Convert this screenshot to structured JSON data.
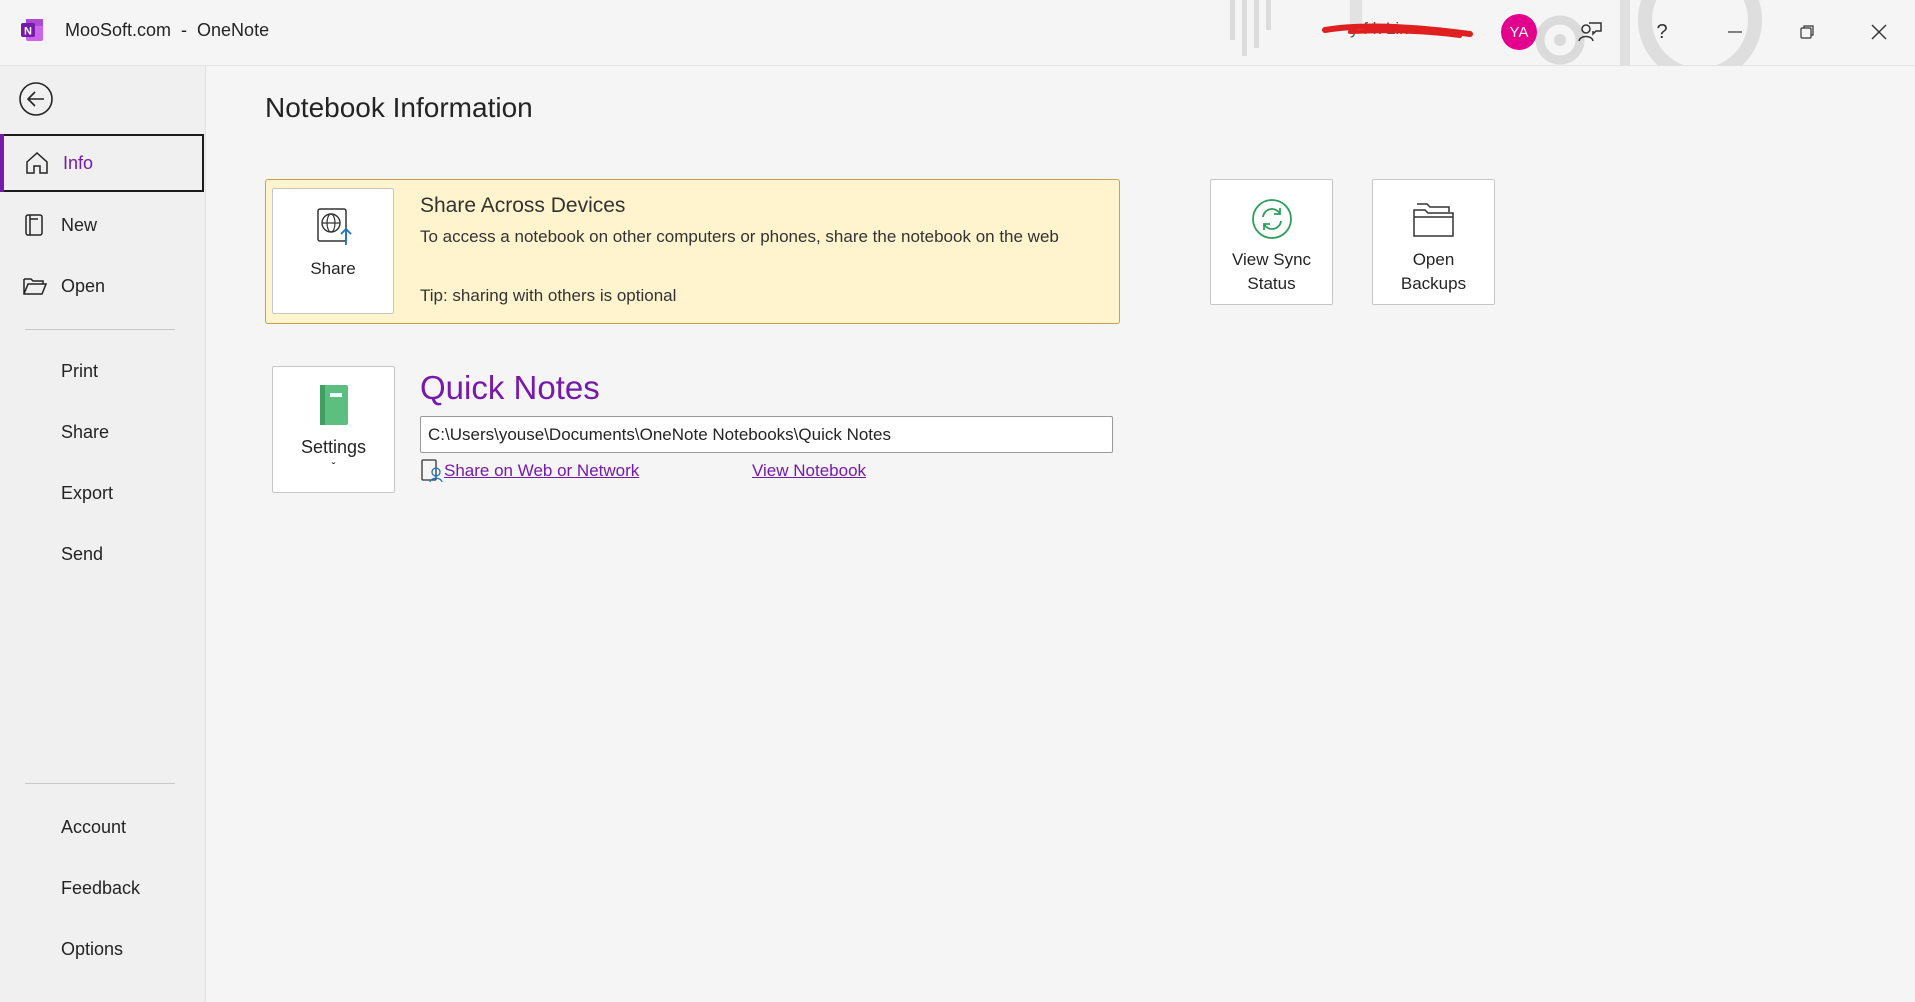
{
  "titlebar": {
    "title": "MooSoft.com  -  OneNote",
    "user_name": "y     f   k  Lin",
    "avatar_initials": "YA",
    "icons": [
      "onenote-logo-icon",
      "feedback-person-icon",
      "help-icon",
      "minimize-icon",
      "restore-icon",
      "close-icon"
    ]
  },
  "sidebar": {
    "items": [
      {
        "label": "Info",
        "icon": "home-icon"
      },
      {
        "label": "New",
        "icon": "new-notebook-icon"
      },
      {
        "label": "Open",
        "icon": "folder-open-icon"
      },
      {
        "label": "Print"
      },
      {
        "label": "Share"
      },
      {
        "label": "Export"
      },
      {
        "label": "Send"
      },
      {
        "label": "Account"
      },
      {
        "label": "Feedback"
      },
      {
        "label": "Options"
      }
    ]
  },
  "main": {
    "title": "Notebook Information",
    "share_panel": {
      "button_label": "Share",
      "heading": "Share Across Devices",
      "description": "To access a notebook on other computers or phones, share the notebook on the web",
      "tip": "Tip: sharing with others is optional"
    },
    "sync_button": {
      "line1": "View Sync",
      "line2": "Status"
    },
    "backup_button": {
      "line1": "Open",
      "line2": "Backups"
    },
    "notebook": {
      "settings_label": "Settings",
      "chevron": "ˇ",
      "name": "Quick Notes",
      "path": "C:\\Users\\youse\\Documents\\OneNote Notebooks\\Quick Notes",
      "share_link": "Share on Web or Network",
      "view_link": "View Notebook"
    }
  },
  "colors": {
    "accent": "#7719aa",
    "share_panel_bg": "#fff4ce",
    "avatar_bg": "#e3008c",
    "sync_green": "#2e9e5b",
    "notebook_green": "#5cbf7f"
  }
}
